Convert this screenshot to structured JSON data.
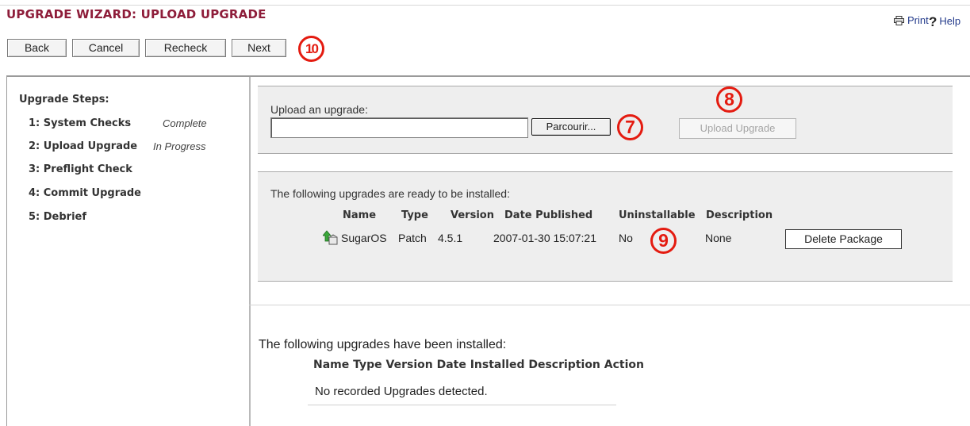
{
  "header": {
    "title": "UPGRADE WIZARD: UPLOAD UPGRADE",
    "print_label": "Print",
    "help_label": "Help"
  },
  "toolbar": {
    "back_label": "Back",
    "cancel_label": "Cancel",
    "recheck_label": "Recheck",
    "next_label": "Next"
  },
  "callouts": {
    "c7": "7",
    "c8": "8",
    "c9": "9",
    "c10": "10"
  },
  "sidebar": {
    "title": "Upgrade Steps:",
    "steps": [
      {
        "label": "1: System Checks",
        "status": "Complete"
      },
      {
        "label": "2: Upload Upgrade",
        "status": "In Progress"
      },
      {
        "label": "3: Preflight Check",
        "status": ""
      },
      {
        "label": "4: Commit Upgrade",
        "status": ""
      },
      {
        "label": "5: Debrief",
        "status": ""
      }
    ]
  },
  "upload": {
    "label": "Upload an upgrade:",
    "file_value": "",
    "browse_label": "Parcourir...",
    "upload_button": "Upload Upgrade"
  },
  "ready": {
    "title": "The following upgrades are ready to be installed:",
    "headers": {
      "name": "Name",
      "type": "Type",
      "version": "Version",
      "date": "Date Published",
      "uninstallable": "Uninstallable",
      "description": "Description"
    },
    "rows": [
      {
        "name": "SugarOS",
        "type": "Patch",
        "version": "4.5.1",
        "date": "2007-01-30 15:07:21",
        "uninstallable": "No",
        "description": "None",
        "action": "Delete Package"
      }
    ]
  },
  "installed": {
    "title": "The following upgrades have been installed:",
    "headers": "Name Type Version Date Installed Description Action",
    "empty_message": "No recorded Upgrades detected."
  },
  "colors": {
    "title": "#8e1d3a",
    "callout": "#e41b10",
    "panel": "#eeeeee",
    "link": "#233a8b"
  },
  "icons": [
    "printer-icon",
    "help-icon",
    "package-upload-icon"
  ]
}
